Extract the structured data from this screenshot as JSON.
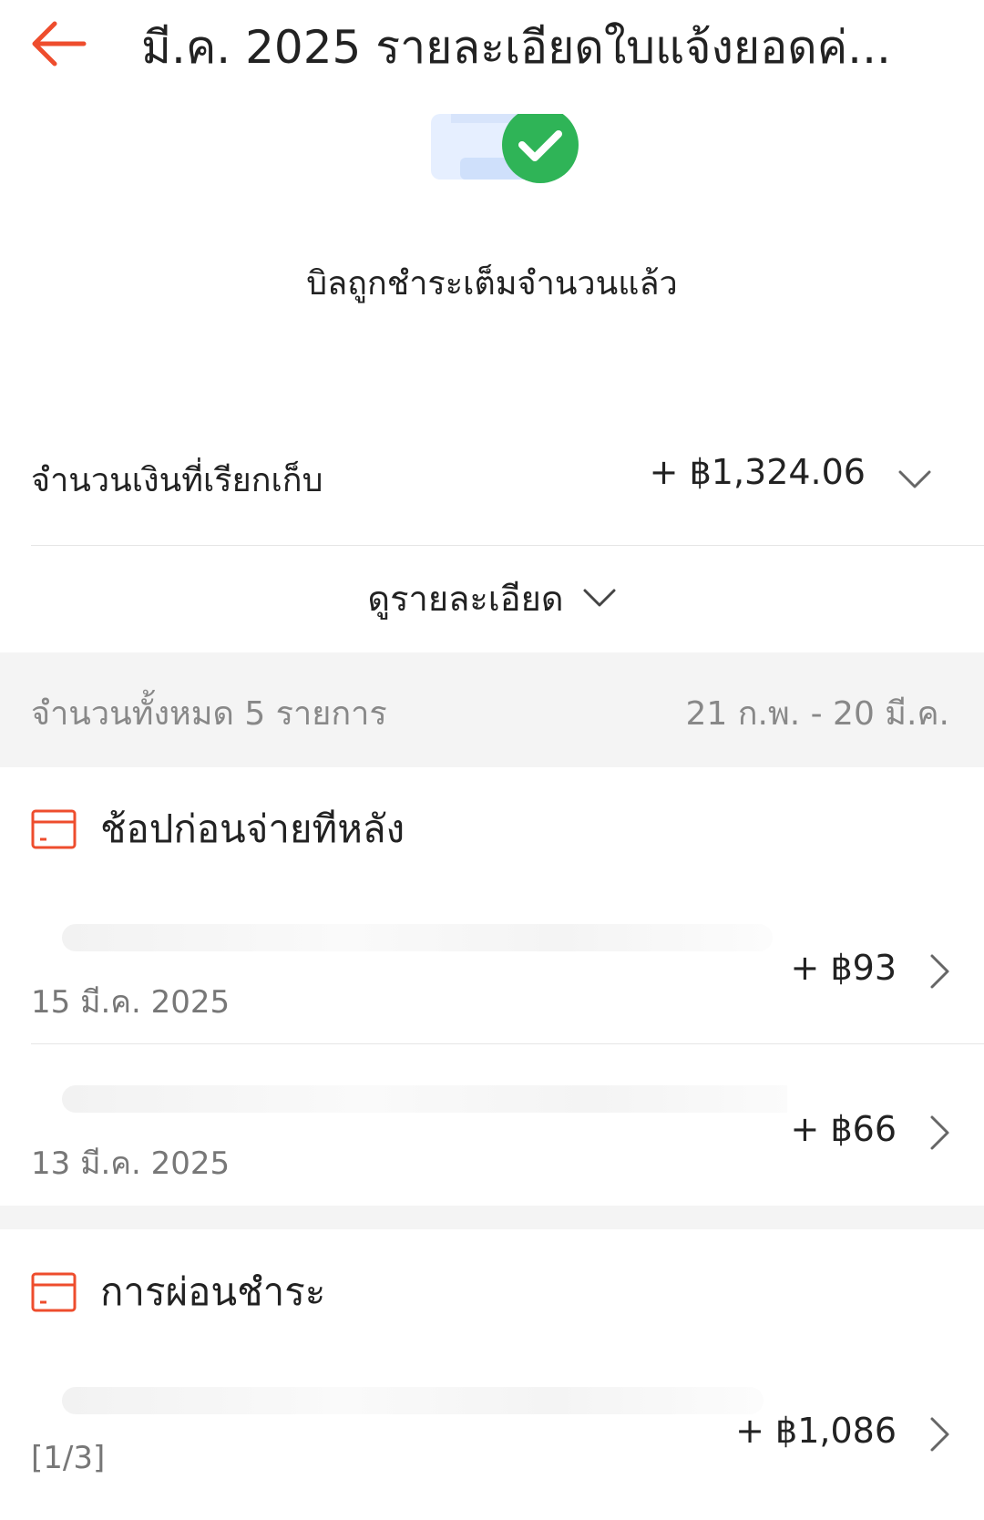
{
  "header": {
    "title": "มี.ค. 2025 รายละเอียดใบแจ้งยอดค่..."
  },
  "status": {
    "text": "บิลถูกชำระเต็มจำนวนแล้ว"
  },
  "amount": {
    "label": "จำนวนเงินที่เรียกเก็บ",
    "value": "+ ฿1,324.06"
  },
  "details": {
    "label": "ดูรายละเอียด"
  },
  "summary": {
    "count_text": "จำนวนทั้งหมด 5 รายการ",
    "date_range": "21 ก.พ. - 20 มี.ค."
  },
  "sections": [
    {
      "title": "ช้อปก่อนจ่ายทีหลัง",
      "transactions": [
        {
          "date": "15 มี.ค. 2025",
          "amount": "+ ฿93"
        },
        {
          "date": "13 มี.ค. 2025",
          "amount": "+ ฿66"
        }
      ]
    },
    {
      "title": "การผ่อนชำระ",
      "transactions": [
        {
          "date": "[1/3]",
          "amount": "+ ฿1,086"
        }
      ]
    }
  ],
  "colors": {
    "accent": "#ee4d2d",
    "success": "#2fb457",
    "muted_text": "#888888",
    "band": "#f4f4f4"
  },
  "icons": {
    "back": "arrow-left-icon",
    "hero": "bill-paid-check-icon",
    "section": "card-icon",
    "expand": "chevron-down-icon",
    "row": "chevron-right-icon"
  }
}
